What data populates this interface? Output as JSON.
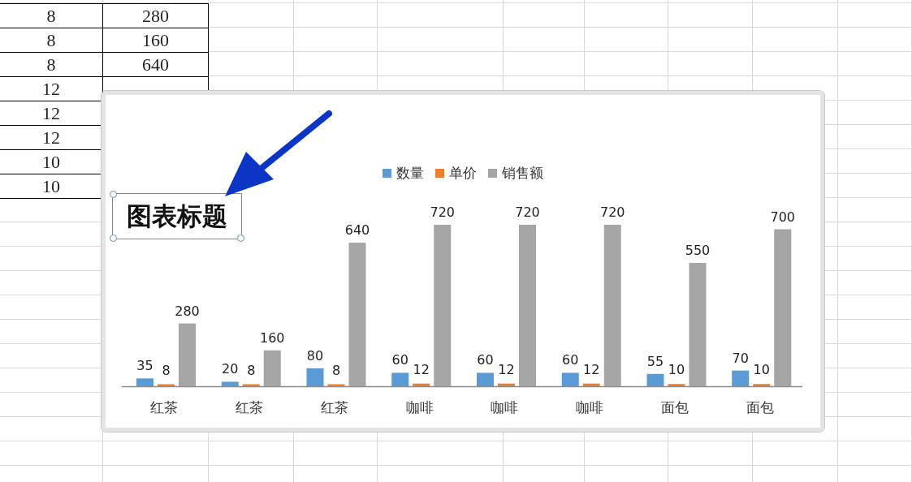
{
  "sheet": {
    "rows": [
      {
        "column_1": "8",
        "column_2": "280"
      },
      {
        "column_1": "8",
        "column_2": "160"
      },
      {
        "column_1": "8",
        "column_2": "640"
      },
      {
        "column_1": "12"
      },
      {
        "column_1": "12"
      },
      {
        "column_1": "12"
      },
      {
        "column_1": "10"
      },
      {
        "column_1": "10"
      }
    ]
  },
  "chart": {
    "chart_data": {
      "type": "bar",
      "title": "图表标题",
      "categories": [
        "红茶",
        "红茶",
        "红茶",
        "咖啡",
        "咖啡",
        "咖啡",
        "面包",
        "面包"
      ],
      "series": [
        {
          "name": "数量",
          "color": "#5b9bd5",
          "values": [
            35,
            20,
            80,
            60,
            60,
            60,
            55,
            70
          ]
        },
        {
          "name": "单价",
          "color": "#ed7d31",
          "values": [
            8,
            8,
            8,
            12,
            12,
            12,
            10,
            10
          ]
        },
        {
          "name": "销售额",
          "color": "#a5a5a5",
          "values": [
            280,
            160,
            640,
            720,
            720,
            720,
            550,
            700
          ]
        }
      ],
      "data_labels": true
    }
  }
}
